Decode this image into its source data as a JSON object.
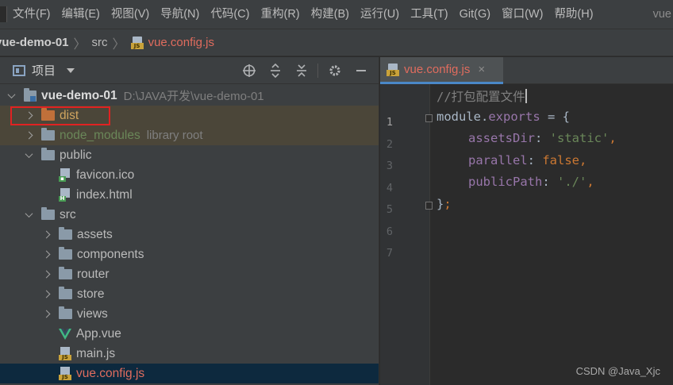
{
  "menubar": {
    "items": [
      "文件(F)",
      "编辑(E)",
      "视图(V)",
      "导航(N)",
      "代码(C)",
      "重构(R)",
      "构建(B)",
      "运行(U)",
      "工具(T)",
      "Git(G)",
      "窗口(W)",
      "帮助(H)"
    ],
    "title_fragment": "vue"
  },
  "breadcrumb": {
    "project": "vue-demo-01",
    "folder": "src",
    "file": "vue.config.js"
  },
  "project_panel": {
    "title": "项目",
    "tools": [
      "locate-icon",
      "expand-all-icon",
      "collapse-all-icon",
      "gear-icon",
      "minimize-icon"
    ],
    "tree": [
      {
        "label": "vue-demo-01",
        "hint": "D:\\JAVA开发\\vue-demo-01",
        "type": "project",
        "state": "expanded",
        "depth": 0
      },
      {
        "label": "dist",
        "hint": "",
        "type": "folder-excluded",
        "state": "collapsed",
        "depth": 1
      },
      {
        "label": "node_modules",
        "hint": "library root",
        "type": "folder-library",
        "state": "collapsed",
        "depth": 1
      },
      {
        "label": "public",
        "hint": "",
        "type": "folder",
        "state": "expanded",
        "depth": 1
      },
      {
        "label": "favicon.ico",
        "hint": "",
        "type": "ico",
        "state": "leaf",
        "depth": 2
      },
      {
        "label": "index.html",
        "hint": "",
        "type": "html",
        "state": "leaf",
        "depth": 2
      },
      {
        "label": "src",
        "hint": "",
        "type": "folder",
        "state": "expanded",
        "depth": 1
      },
      {
        "label": "assets",
        "hint": "",
        "type": "folder",
        "state": "collapsed",
        "depth": 2
      },
      {
        "label": "components",
        "hint": "",
        "type": "folder",
        "state": "collapsed",
        "depth": 2
      },
      {
        "label": "router",
        "hint": "",
        "type": "folder",
        "state": "collapsed",
        "depth": 2
      },
      {
        "label": "store",
        "hint": "",
        "type": "folder",
        "state": "collapsed",
        "depth": 2
      },
      {
        "label": "views",
        "hint": "",
        "type": "folder",
        "state": "collapsed",
        "depth": 2
      },
      {
        "label": "App.vue",
        "hint": "",
        "type": "vue",
        "state": "leaf",
        "depth": 2
      },
      {
        "label": "main.js",
        "hint": "",
        "type": "js",
        "state": "leaf",
        "depth": 2
      },
      {
        "label": "vue.config.js",
        "hint": "",
        "type": "js",
        "state": "leaf",
        "depth": 2
      }
    ]
  },
  "editor": {
    "tab_label": "vue.config.js",
    "tab_close": "×",
    "line_numbers": [
      "1",
      "2",
      "3",
      "4",
      "5",
      "6",
      "7"
    ],
    "code": {
      "l1_comment": "//打包配置文件",
      "l2_module": "module",
      "l2_dot": ".",
      "l2_exports": "exports",
      "l2_rest": " = {",
      "l3_key": "assetsDir",
      "l3_colon": ": ",
      "l3_val": "'static'",
      "l3_comma": ",",
      "l4_key": "parallel",
      "l4_colon": ": ",
      "l4_val": "false",
      "l4_comma": ",",
      "l5_key": "publicPath",
      "l5_colon": ": ",
      "l5_val": "'./'",
      "l5_comma": ",",
      "l6_close": "}",
      "l6_semi": ";"
    }
  },
  "watermark": "CSDN @Java_Xjc",
  "colors": {
    "accent": "#4a88c7",
    "highlight_box": "#e02222",
    "modified_file": "#e06c5e"
  }
}
